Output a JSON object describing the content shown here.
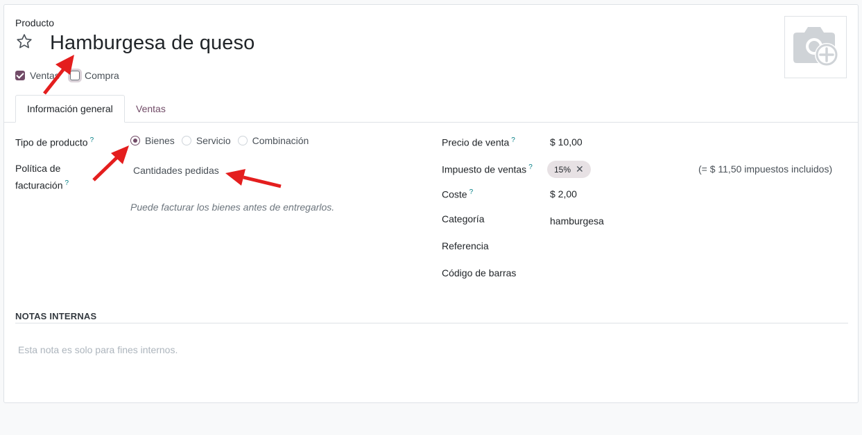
{
  "header": {
    "section_label": "Producto",
    "product_name": "Hamburgesa de queso",
    "checkboxes": [
      {
        "label": "Ventas",
        "checked": true
      },
      {
        "label": "Compra",
        "checked": false
      }
    ]
  },
  "tabs": [
    {
      "label": "Información general",
      "active": true
    },
    {
      "label": "Ventas",
      "active": false
    }
  ],
  "left_fields": {
    "product_type": {
      "label": "Tipo de producto",
      "help": "?",
      "options": [
        {
          "label": "Bienes",
          "selected": true
        },
        {
          "label": "Servicio",
          "selected": false
        },
        {
          "label": "Combinación",
          "selected": false
        }
      ]
    },
    "invoice_policy": {
      "label_line1": "Política de",
      "label_line2": "facturación",
      "help": "?",
      "value": "Cantidades pedidas",
      "hint": "Puede facturar los bienes antes de entregarlos."
    }
  },
  "right_fields": {
    "sale_price": {
      "label": "Precio de venta",
      "help": "?",
      "value": "$ 10,00"
    },
    "sales_tax": {
      "label": "Impuesto de ventas",
      "help": "?",
      "tag": "15%",
      "tag_remove": "✕",
      "note": "(= $ 11,50 impuestos incluidos)"
    },
    "cost": {
      "label": "Coste",
      "help": "?",
      "value": "$ 2,00"
    },
    "category": {
      "label": "Categoría",
      "value": "hamburgesa"
    },
    "reference": {
      "label": "Referencia",
      "value": ""
    },
    "barcode": {
      "label": "Código de barras",
      "value": ""
    }
  },
  "notes": {
    "title": "NOTAS INTERNAS",
    "placeholder": "Esta nota es solo para fines internos."
  },
  "icons": {
    "favorite": "star-outline-icon",
    "photo": "camera-add-icon"
  },
  "colors": {
    "accent": "#714b67",
    "annotation_arrow": "#e41e1e",
    "help": "#017e84"
  }
}
